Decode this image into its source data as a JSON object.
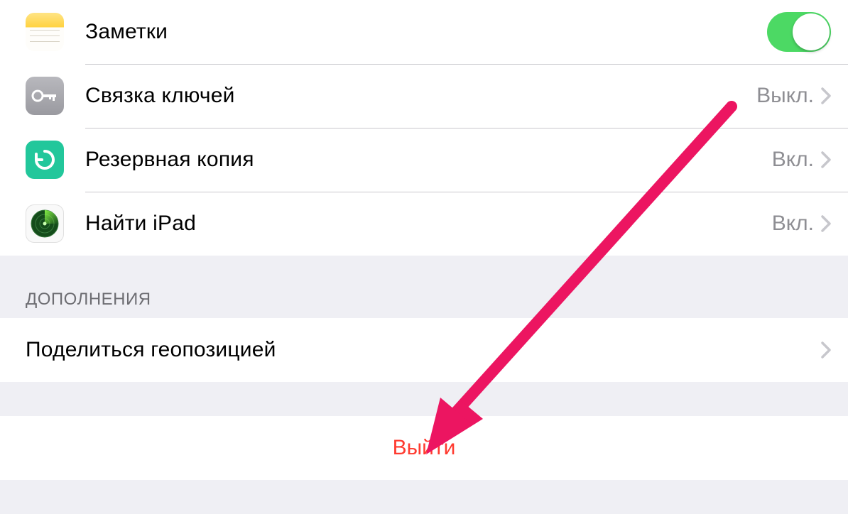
{
  "group1": {
    "notes": {
      "label": "Заметки",
      "toggle_on": true
    },
    "keychain": {
      "label": "Связка ключей",
      "detail": "Выкл."
    },
    "backup": {
      "label": "Резервная копия",
      "detail": "Вкл."
    },
    "find": {
      "label": "Найти iPad",
      "detail": "Вкл."
    }
  },
  "section_header": "ДОПОЛНЕНИЯ",
  "share_location": {
    "label": "Поделиться геопозицией"
  },
  "signout": {
    "label": "Выйти"
  },
  "colors": {
    "toggle_on": "#4cd964",
    "destructive": "#ff3b30",
    "arrow": "#ec1561"
  }
}
